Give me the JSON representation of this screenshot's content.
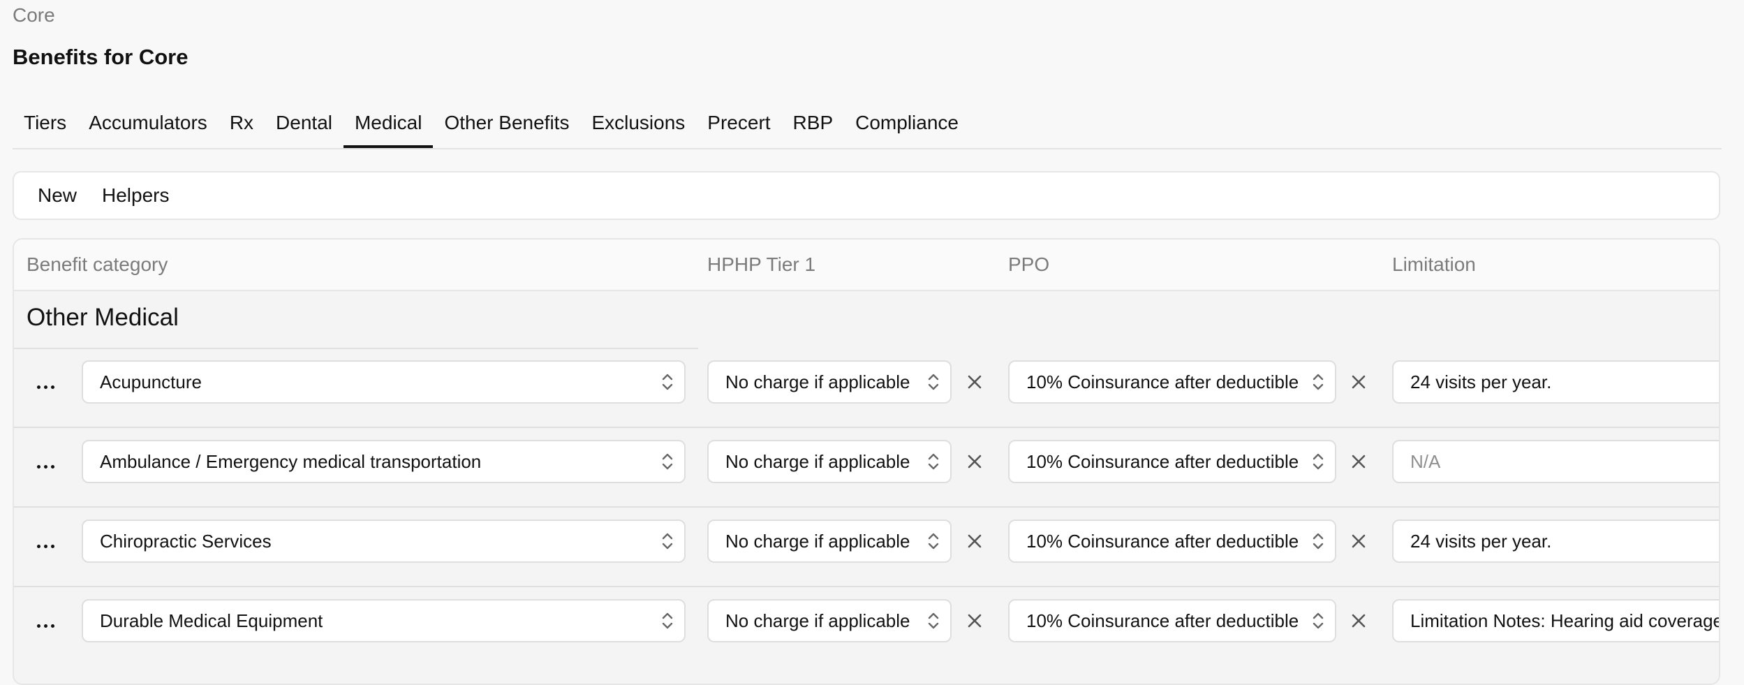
{
  "breadcrumb": "Core",
  "page_title": "Benefits for Core",
  "tabs": [
    {
      "label": "Tiers"
    },
    {
      "label": "Accumulators"
    },
    {
      "label": "Rx"
    },
    {
      "label": "Dental"
    },
    {
      "label": "Medical",
      "active": true
    },
    {
      "label": "Other Benefits"
    },
    {
      "label": "Exclusions"
    },
    {
      "label": "Precert"
    },
    {
      "label": "RBP"
    },
    {
      "label": "Compliance"
    }
  ],
  "toolbar": {
    "new_label": "New",
    "helpers_label": "Helpers"
  },
  "table": {
    "columns": [
      "Benefit category",
      "HPHP Tier 1",
      "PPO",
      "Limitation"
    ],
    "group_title": "Other Medical",
    "rows": [
      {
        "category": "Acupuncture",
        "hphp": "No charge if applicable",
        "ppo": "10% Coinsurance after deductible",
        "limitation": "24 visits per year.",
        "limitation_placeholder": ""
      },
      {
        "category": "Ambulance / Emergency medical transportation",
        "hphp": "No charge if applicable",
        "ppo": "10% Coinsurance after deductible",
        "limitation": "",
        "limitation_placeholder": "N/A"
      },
      {
        "category": "Chiropractic Services",
        "hphp": "No charge if applicable",
        "ppo": "10% Coinsurance after deductible",
        "limitation": "24 visits per year.",
        "limitation_placeholder": ""
      },
      {
        "category": "Durable Medical Equipment",
        "hphp": "No charge if applicable",
        "ppo": "10% Coinsurance after deductible",
        "limitation": "Limitation Notes: Hearing aid coverage",
        "limitation_placeholder": ""
      }
    ]
  },
  "icons": {
    "row_menu": "more-horizontal-icon",
    "select_chevron": "chevron-up-down-icon",
    "clear": "close-icon"
  }
}
